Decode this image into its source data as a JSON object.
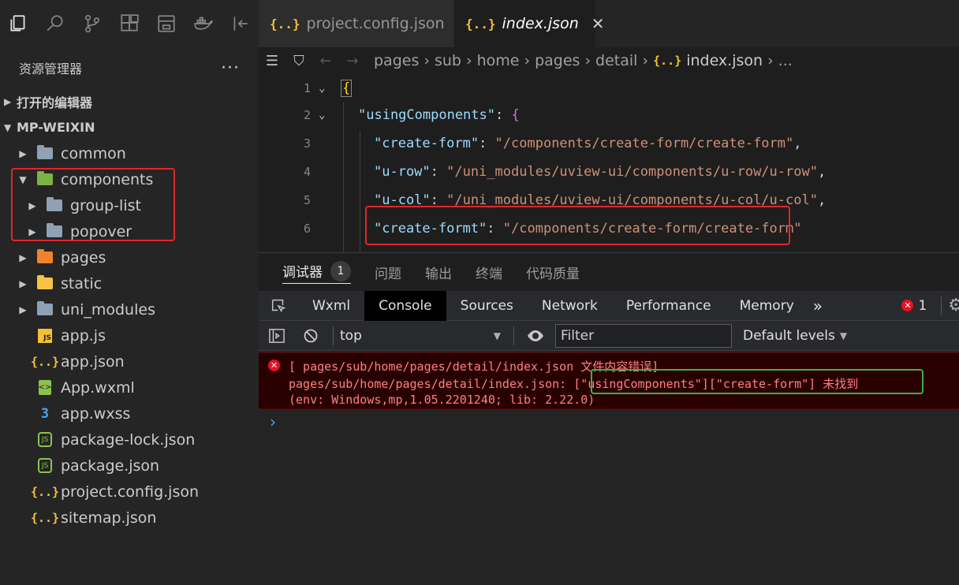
{
  "sidebar": {
    "title": "资源管理器",
    "more": "···",
    "open_editors": "打开的编辑器",
    "workspace": "MP-WEIXIN",
    "tree": [
      {
        "label": "common"
      },
      {
        "label": "components"
      },
      {
        "label": "group-list"
      },
      {
        "label": "popover"
      },
      {
        "label": "pages"
      },
      {
        "label": "static"
      },
      {
        "label": "uni_modules"
      },
      {
        "label": "app.js"
      },
      {
        "label": "app.json"
      },
      {
        "label": "App.wxml"
      },
      {
        "label": "app.wxss"
      },
      {
        "label": "package-lock.json"
      },
      {
        "label": "package.json"
      },
      {
        "label": "project.config.json"
      },
      {
        "label": "sitemap.json"
      }
    ]
  },
  "tabs": [
    {
      "label": "project.config.json",
      "icon": "{..}"
    },
    {
      "label": "index.json",
      "icon": "{..}",
      "close": "✕"
    }
  ],
  "breadcrumb": {
    "parts": [
      "pages",
      "sub",
      "home",
      "pages",
      "detail"
    ],
    "file": "index.json",
    "file_icon": "{..}",
    "tail": "..."
  },
  "editor": {
    "lines": [
      {
        "n": "1"
      },
      {
        "n": "2",
        "key": "\"usingComponents\""
      },
      {
        "n": "3",
        "key": "\"create-form\"",
        "val": "\"/components/create-form/create-form\""
      },
      {
        "n": "4",
        "key": "\"u-row\"",
        "val": "\"/uni_modules/uview-ui/components/u-row/u-row\""
      },
      {
        "n": "5",
        "key": "\"u-col\"",
        "val": "\"/uni_modules/uview-ui/components/u-col/u-col\""
      },
      {
        "n": "6",
        "key": "\"create-formt\"",
        "val": "\"/components/create-form/create-form\""
      }
    ]
  },
  "panel": {
    "tabs": [
      "调试器",
      "问题",
      "输出",
      "终端",
      "代码质量"
    ],
    "badge": "1"
  },
  "devtools": {
    "tabs": [
      "Wxml",
      "Console",
      "Sources",
      "Network",
      "Performance",
      "Memory"
    ],
    "more": "»",
    "error_count": "1",
    "context": "top",
    "filter_placeholder": "Filter",
    "levels": "Default levels"
  },
  "console": {
    "error_line1": "[ pages/sub/home/pages/detail/index.json 文件内容错误]",
    "error_line2a": "pages/sub/home/pages/detail/index.json: ",
    "error_line2b": "[\"usingComponents\"][\"create-form\"] 未找到",
    "error_line3": "(env: Windows,mp,1.05.2201240; lib: 2.22.0)",
    "prompt": "›"
  },
  "colors": {
    "error_text": "#ff8080",
    "highlight_red": "#e0262a",
    "highlight_green": "#3cb043"
  }
}
